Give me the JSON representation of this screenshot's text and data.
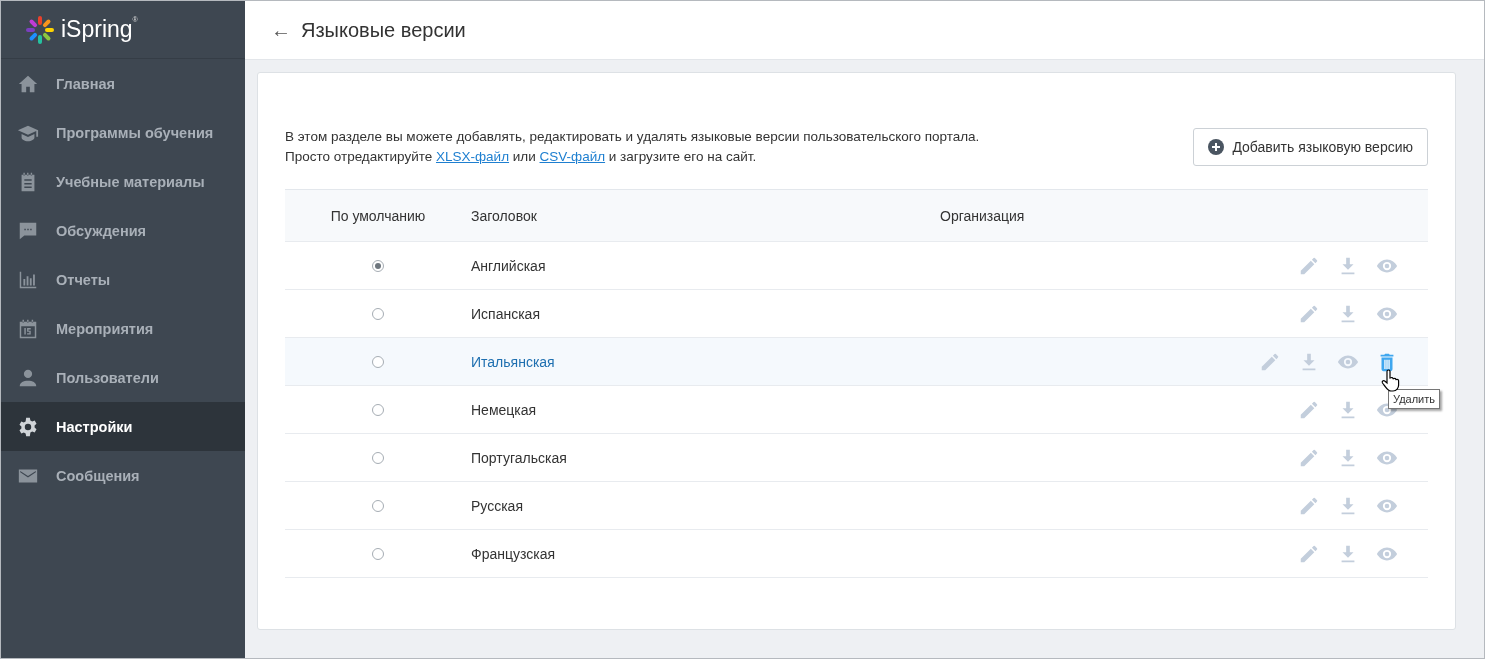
{
  "logo": {
    "name": "iSpring",
    "mark": "®"
  },
  "sidebar": {
    "items": [
      {
        "label": "Главная",
        "kind": "home",
        "selected": false
      },
      {
        "label": "Программы обучения",
        "kind": "cap",
        "selected": false
      },
      {
        "label": "Учебные материалы",
        "kind": "notepad",
        "selected": false
      },
      {
        "label": "Обсуждения",
        "kind": "chat",
        "selected": false
      },
      {
        "label": "Отчеты",
        "kind": "chart",
        "selected": false
      },
      {
        "label": "Мероприятия",
        "kind": "calendar",
        "selected": false
      },
      {
        "label": "Пользователи",
        "kind": "user",
        "selected": false
      },
      {
        "label": "Настройки",
        "kind": "gear",
        "selected": true
      },
      {
        "label": "Сообщения",
        "kind": "mail",
        "selected": false
      }
    ]
  },
  "header": {
    "back": "←",
    "title": "Языковые версии"
  },
  "description": {
    "line1": "В этом разделе вы можете добавлять, редактировать и удалять языковые версии пользовательского портала.",
    "before": "Просто отредактируйте",
    "link1": "XLSX-файл",
    "between": "или",
    "link2": "CSV-файл",
    "after": "и загрузите его на сайт."
  },
  "add_button": {
    "label": "Добавить языковую версию"
  },
  "table": {
    "columns": [
      "По умолчанию",
      "Заголовок",
      "Организация"
    ],
    "rows": [
      {
        "title": "Английская",
        "selected": true,
        "hovered": false
      },
      {
        "title": "Испанская",
        "selected": false,
        "hovered": false
      },
      {
        "title": "Итальянская",
        "selected": false,
        "hovered": true
      },
      {
        "title": "Немецкая",
        "selected": false,
        "hovered": false
      },
      {
        "title": "Португальская",
        "selected": false,
        "hovered": false
      },
      {
        "title": "Русская",
        "selected": false,
        "hovered": false
      },
      {
        "title": "Французская",
        "selected": false,
        "hovered": false
      }
    ]
  },
  "tooltip": {
    "text": "Удалить"
  }
}
